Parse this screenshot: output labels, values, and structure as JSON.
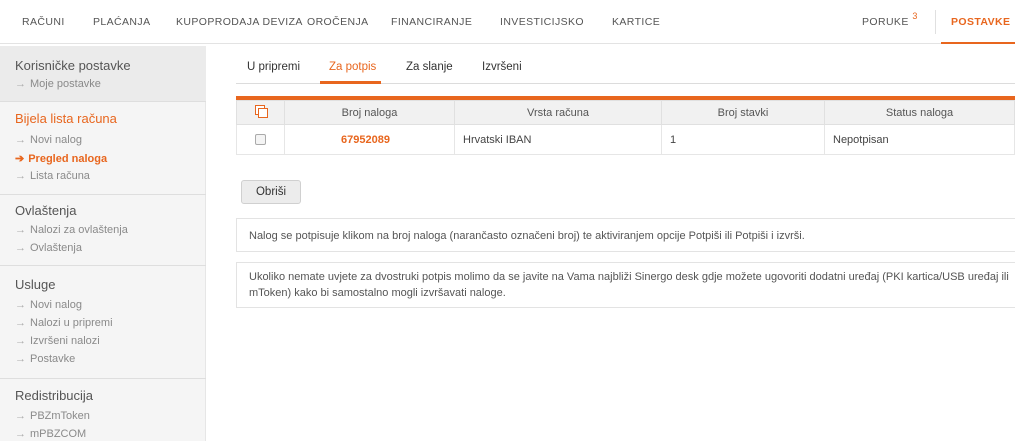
{
  "nav": {
    "items": [
      "RAČUNI",
      "PLAĆANJA",
      "KUPOPRODAJA DEVIZA",
      "OROČENJA",
      "FINANCIRANJE",
      "INVESTICIJSKO",
      "KARTICE"
    ],
    "messages": "PORUKE",
    "messages_badge": "3",
    "settings": "POSTAVKE"
  },
  "sidebar": {
    "s1_title": "Korisničke postavke",
    "s1_links": [
      "Moje postavke"
    ],
    "s2_title": "Bijela lista računa",
    "s2_links": [
      "Novi nalog",
      "Pregled naloga",
      "Lista računa"
    ],
    "s3_title": "Ovlaštenja",
    "s3_links": [
      "Nalozi za ovlaštenja",
      "Ovlaštenja"
    ],
    "s4_title": "Usluge",
    "s4_links": [
      "Novi nalog",
      "Nalozi u pripremi",
      "Izvršeni nalozi",
      "Postavke"
    ],
    "s5_title": "Redistribucija",
    "s5_links": [
      "PBZmToken",
      "mPBZCOM"
    ],
    "arrow": "→",
    "current_arrow": "➔"
  },
  "tabs": [
    "U pripremi",
    "Za potpis",
    "Za slanje",
    "Izvršeni"
  ],
  "table": {
    "headers": [
      "Broj naloga",
      "Vrsta računa",
      "Broj stavki",
      "Status naloga"
    ],
    "rows": [
      {
        "number": "67952089",
        "type": "Hrvatski IBAN",
        "items": "1",
        "status": "Nepotpisan"
      }
    ]
  },
  "delete_button": "Obriši",
  "notice1": "Nalog se potpisuje klikom na broj naloga (narančasto označeni broj) te aktiviranjem opcije Potpiši ili Potpiši i izvrši.",
  "notice2": "Ukoliko nemate uvjete za dvostruki potpis molimo da se javite na Vama najbliži Sinergo desk gdje možete ugovoriti dodatni uređaj (PKI kartica/USB uređaj ili mToken) kako bi samostalno mogli izvršavati naloge.",
  "colors": {
    "accent": "#e8661e"
  }
}
